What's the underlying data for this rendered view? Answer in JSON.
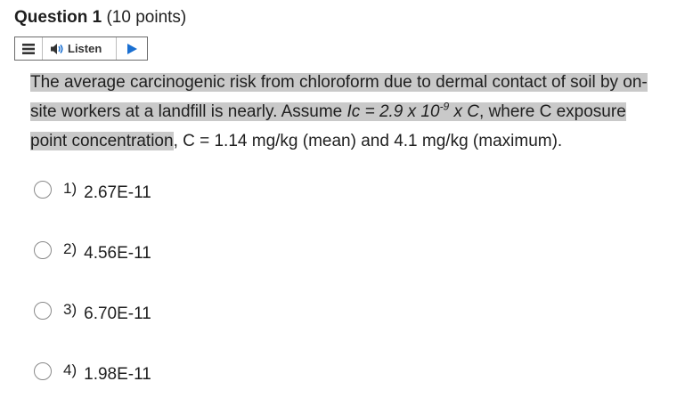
{
  "question": {
    "title": "Question 1",
    "points": "(10 points)"
  },
  "listen": {
    "label": "Listen",
    "menu_icon": "hamburger-icon",
    "speaker_icon": "speaker-icon",
    "play_icon": "play-icon",
    "accent_color": "#1a6fd1"
  },
  "text": {
    "part1": "The average carcinogenic risk from chloroform due to dermal contact of soil by on-site workers at a landfill is nearly.  Assume ",
    "formula_lhs": "Ic",
    "formula_eq": " = 2.9 x 10",
    "formula_exp": "-9",
    "formula_rhs": " x C",
    "part2": ", where C exposure point concentration",
    "part3": ", C = 1.14 mg/kg (mean) and 4.1 mg/kg (maximum)."
  },
  "options": [
    {
      "num": "1)",
      "value": "2.67E-11"
    },
    {
      "num": "2)",
      "value": "4.56E-11"
    },
    {
      "num": "3)",
      "value": "6.70E-11"
    },
    {
      "num": "4)",
      "value": "1.98E-11"
    }
  ]
}
